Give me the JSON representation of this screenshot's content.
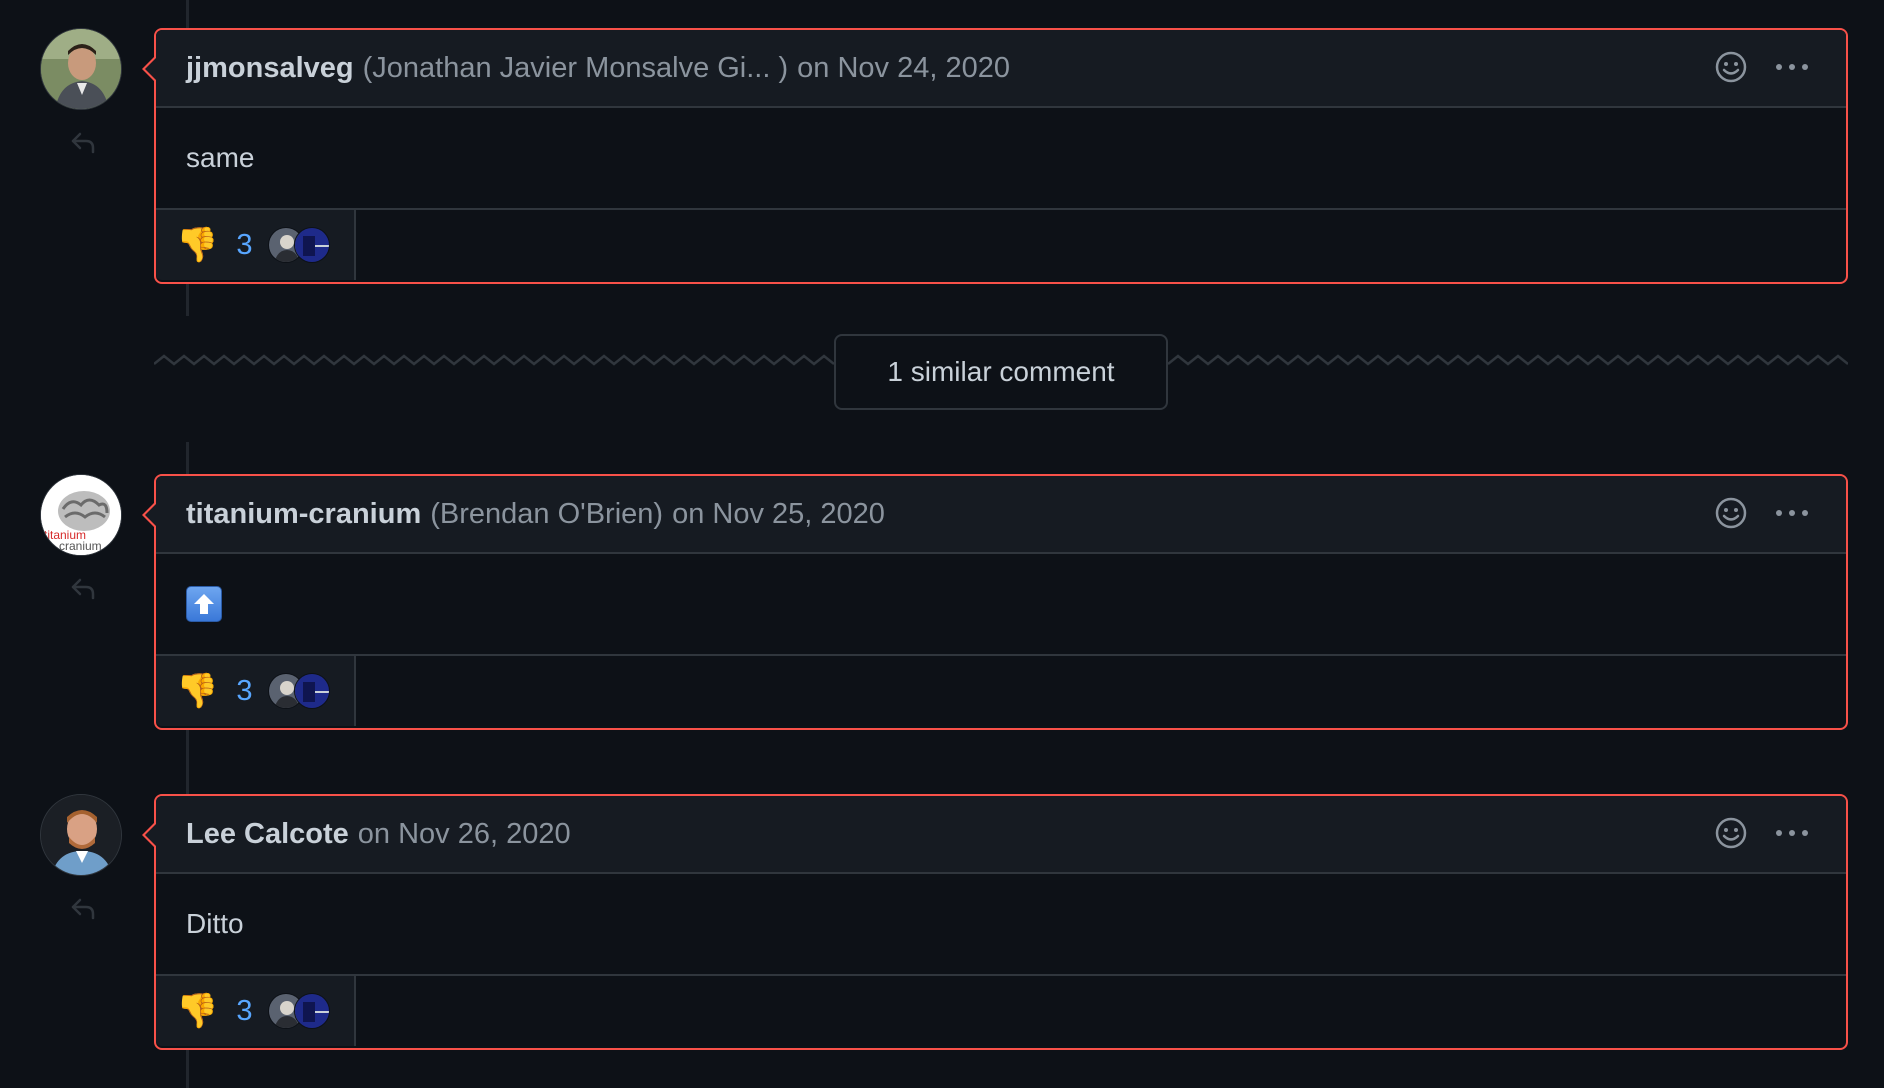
{
  "comments": [
    {
      "author": "jjmonsalveg",
      "fullname": "(Jonathan Javier Monsalve Gi... )",
      "date": "on Nov 24, 2020",
      "body": "same",
      "reaction": {
        "emoji": "👎",
        "count": "3"
      }
    },
    {
      "author": "titanium-cranium",
      "fullname": "(Brendan O'Brien)",
      "date": "on Nov 25, 2020",
      "body_emoji": "up-arrow-icon",
      "reaction": {
        "emoji": "👎",
        "count": "3"
      }
    },
    {
      "author": "Lee Calcote",
      "fullname": "",
      "date": "on Nov 26, 2020",
      "body": "Ditto",
      "reaction": {
        "emoji": "👎",
        "count": "3"
      }
    }
  ],
  "similar": {
    "label": "1 similar comment"
  },
  "avatar_text": {
    "titanium_logo_top": "titanium",
    "titanium_logo_bottom": "cranium"
  },
  "colors": {
    "background": "#0d1117",
    "header_bg": "#161b22",
    "highlight_border": "#f85149",
    "link_blue": "#58a6ff",
    "muted_text": "#8b949e"
  }
}
